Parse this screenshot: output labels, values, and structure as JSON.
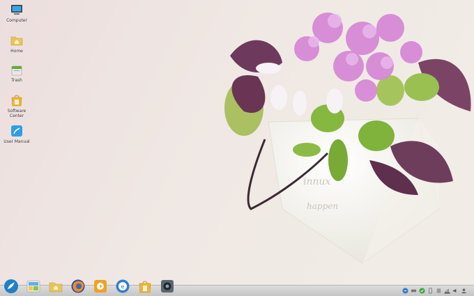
{
  "desktop": {
    "icons": [
      {
        "label": "Computer"
      },
      {
        "label": "Home"
      },
      {
        "label": "Trash"
      },
      {
        "label": "Software Center"
      },
      {
        "label": "User Manual"
      }
    ]
  },
  "taskbar": {
    "apps": [
      "start-menu",
      "file-manager-or-desktop",
      "home-folder",
      "firefox",
      "media-player",
      "browser",
      "software-center",
      "webcam"
    ]
  },
  "colors": {
    "taskbar": "#cfcfcf",
    "accent": "#1e90d6"
  }
}
